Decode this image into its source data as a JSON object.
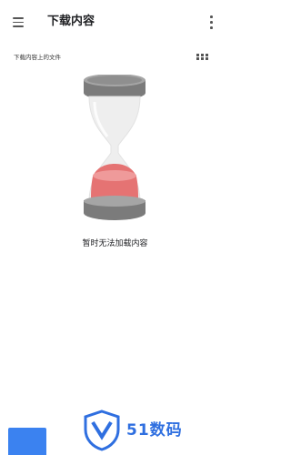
{
  "appbar": {
    "title": "下载内容",
    "menu_icon": "menu-icon",
    "more_icon": "more-vert-icon"
  },
  "section": {
    "label": "下载内容上的文件",
    "view_icon": "grid-view-icon"
  },
  "empty_state": {
    "illustration": "hourglass-icon",
    "message": "暂时无法加载内容"
  },
  "watermark": {
    "text": "51数码",
    "logo": "shield-logo"
  },
  "colors": {
    "sand": "#e57373",
    "cap": "#8a8a8a",
    "watermark": "#2f6fe0",
    "blue_block": "#3b82f0"
  }
}
